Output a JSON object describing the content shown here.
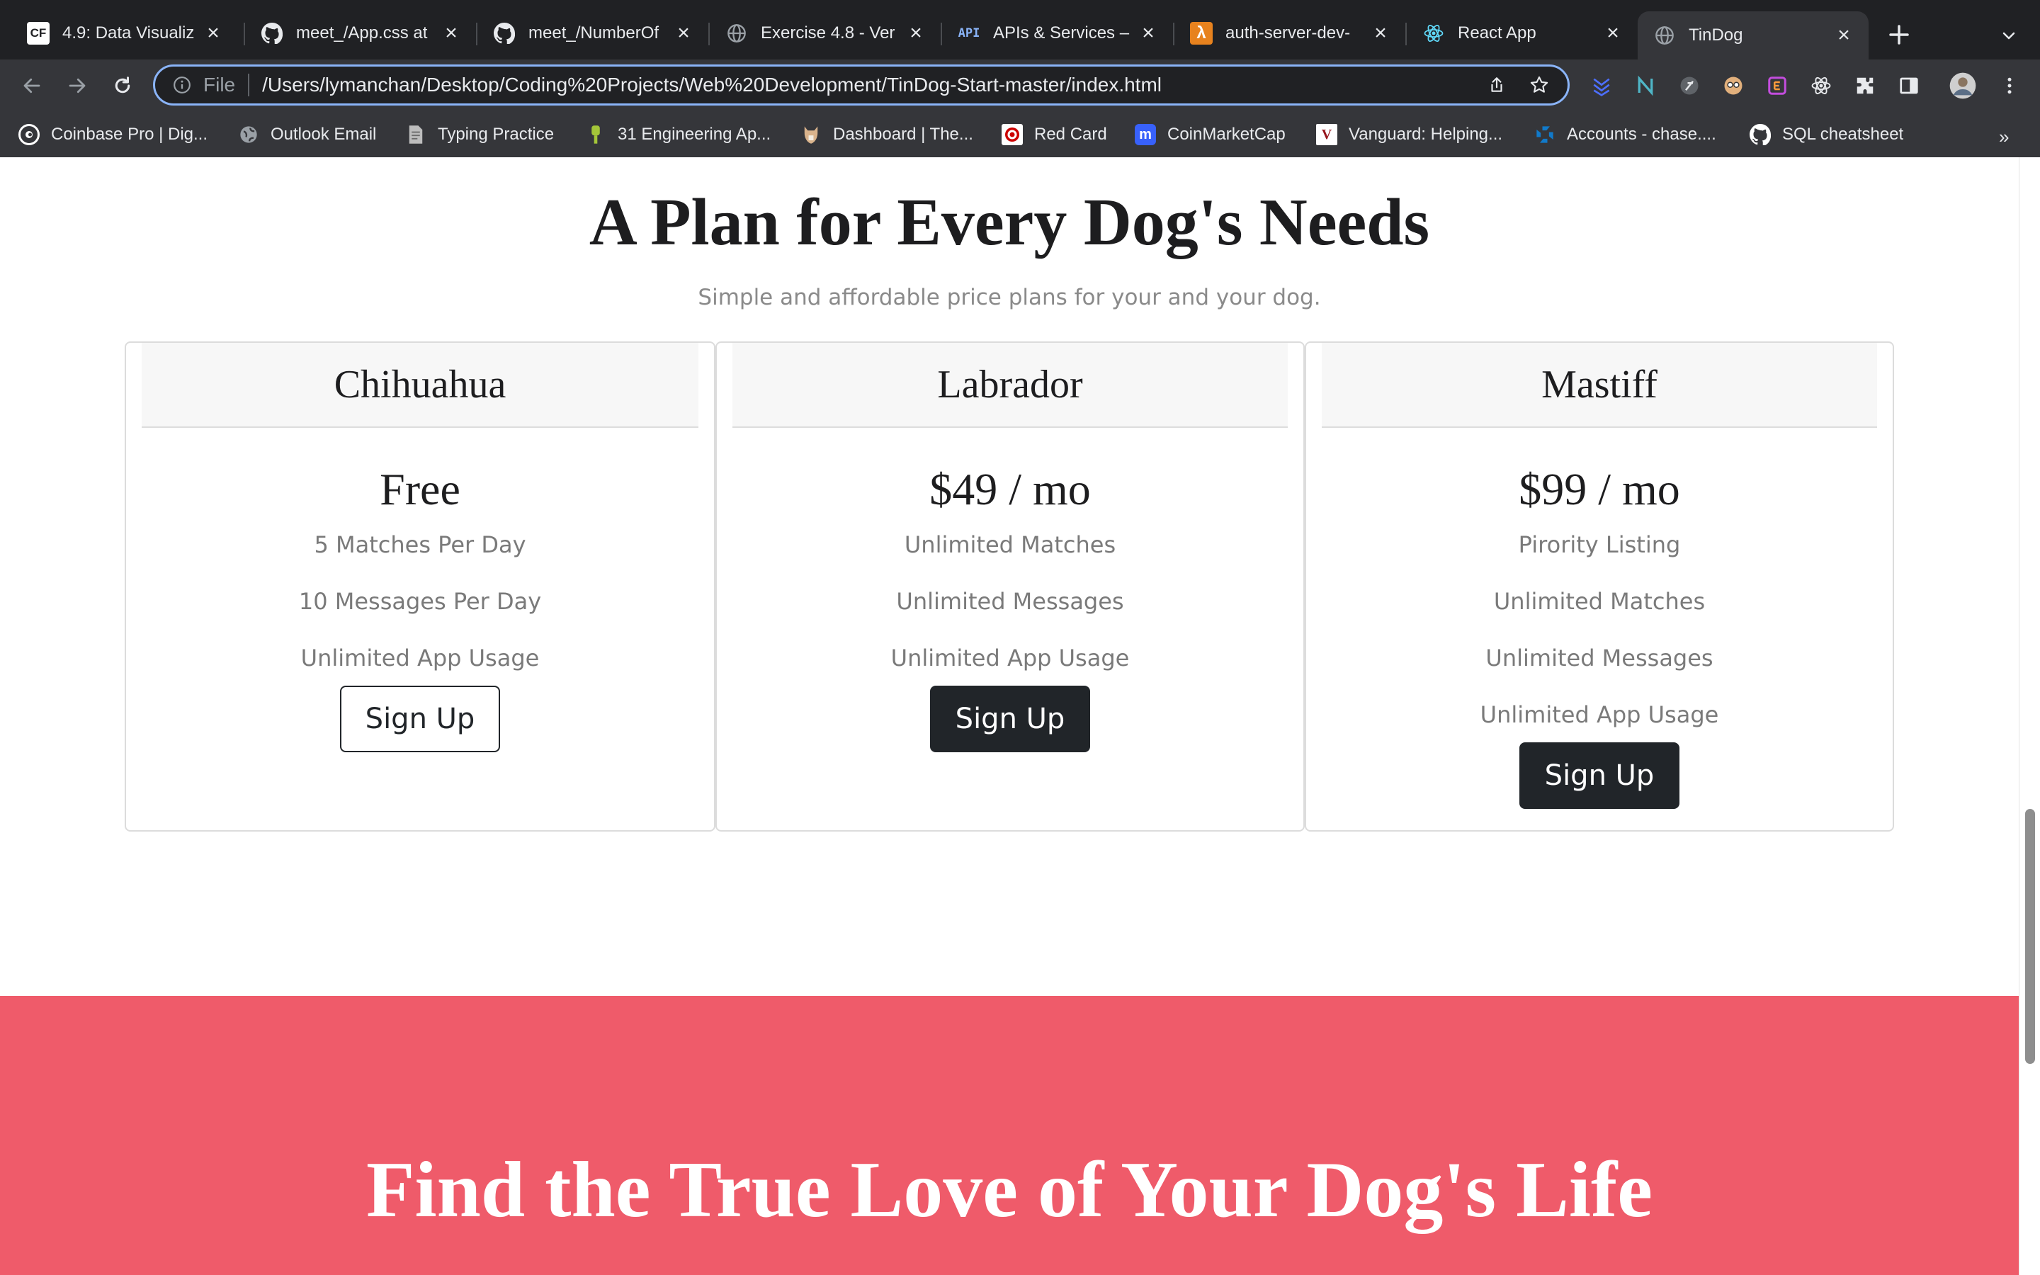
{
  "browser": {
    "tabs": [
      {
        "title": "4.9: Data Visualiz",
        "icon": "careerfoundry-icon",
        "active": false
      },
      {
        "title": "meet_/App.css at",
        "icon": "github-icon",
        "active": false
      },
      {
        "title": "meet_/NumberOf",
        "icon": "github-icon",
        "active": false
      },
      {
        "title": "Exercise 4.8 - Ver",
        "icon": "globe-icon",
        "active": false
      },
      {
        "title": "APIs & Services –",
        "icon": "api-icon",
        "active": false
      },
      {
        "title": "auth-server-dev-",
        "icon": "aws-lambda-icon",
        "active": false
      },
      {
        "title": "React App",
        "icon": "react-icon",
        "active": false
      },
      {
        "title": "TinDog",
        "icon": "globe-icon",
        "active": true
      }
    ],
    "tab_glyphs": {
      "careerfoundry": "CF",
      "api": "API",
      "lambda": "λ"
    },
    "address_bar": {
      "scheme_label": "File",
      "url": "/Users/lymanchan/Desktop/Coding%20Projects/Web%20Development/TinDog-Start-master/index.html"
    },
    "bookmarks": [
      {
        "label": "Coinbase Pro | Dig...",
        "icon": "coinbase-icon",
        "color": "#ffffff"
      },
      {
        "label": "Outlook Email",
        "icon": "globe-icon",
        "color": "#9aa0a6"
      },
      {
        "label": "Typing Practice",
        "icon": "document-icon",
        "color": "#bdbdbd"
      },
      {
        "label": "31 Engineering Ap...",
        "icon": "android-icon",
        "color": "#a4c639"
      },
      {
        "label": "Dashboard | The...",
        "icon": "odin-icon",
        "color": "#d9b38c"
      },
      {
        "label": "Red Card",
        "icon": "target-icon",
        "color": "#cc0000"
      },
      {
        "label": "CoinMarketCap",
        "icon": "coinmarketcap-icon",
        "color": "#3861fb"
      },
      {
        "label": "Vanguard: Helping...",
        "icon": "vanguard-icon",
        "color": "#96151d"
      },
      {
        "label": "Accounts - chase....",
        "icon": "chase-icon",
        "color": "#117aca"
      },
      {
        "label": "SQL cheatsheet",
        "icon": "github-icon",
        "color": "#ffffff"
      }
    ],
    "bookmark_glyphs": {
      "vanguard": "V",
      "coinmarketcap": "m"
    },
    "bookmarks_overflow": "»"
  },
  "page": {
    "pricing": {
      "title": "A Plan for Every Dog's Needs",
      "subtitle": "Simple and affordable price plans for your and your dog.",
      "plans": [
        {
          "name": "Chihuahua",
          "price": "Free",
          "features": [
            "5 Matches Per Day",
            "10 Messages Per Day",
            "Unlimited App Usage"
          ],
          "button": "Sign Up",
          "button_style": "outline"
        },
        {
          "name": "Labrador",
          "price": "$49 / mo",
          "features": [
            "Unlimited Matches",
            "Unlimited Messages",
            "Unlimited App Usage"
          ],
          "button": "Sign Up",
          "button_style": "dark"
        },
        {
          "name": "Mastiff",
          "price": "$99 / mo",
          "features": [
            "Pirority Listing",
            "Unlimited Matches",
            "Unlimited Messages",
            "Unlimited App Usage"
          ],
          "button": "Sign Up",
          "button_style": "dark"
        }
      ]
    },
    "cta": {
      "title": "Find the True Love of Your Dog's Life",
      "background": "#ef5b6a"
    }
  },
  "colors": {
    "chrome_dark": "#202124",
    "chrome_toolbar": "#35363a",
    "omnibox_focus": "#8ab4f8",
    "button_dark": "#212529",
    "cta_red": "#ef5b6a"
  }
}
